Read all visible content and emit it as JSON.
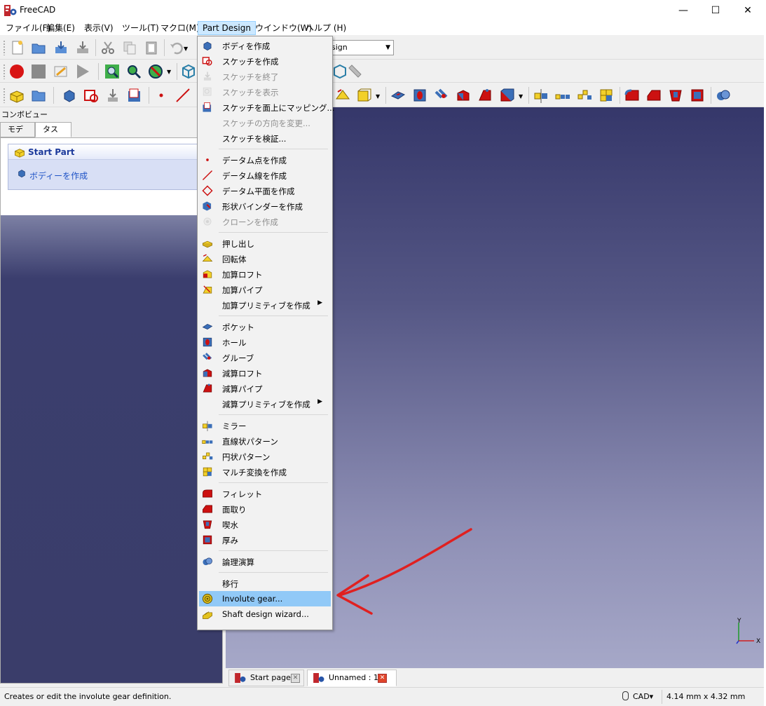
{
  "window": {
    "title": "FreeCAD",
    "minimize_glyph": "—",
    "maximize_glyph": "☐",
    "close_glyph": "✕"
  },
  "menubar": [
    "ファイル(F)",
    "編集(E)",
    "表示(V)",
    "ツール(T)",
    "マクロ(M)",
    "Part Design",
    "ウインドウ(W)",
    "ヘルプ (H)"
  ],
  "workbench_selector": {
    "value": "sign"
  },
  "combo_view": {
    "title": "コンボビュー",
    "tabs": [
      "モデル",
      "タスク"
    ],
    "active_tab": "タスク",
    "task_header": "Start Part",
    "task_item": "ボディーを作成"
  },
  "part_design_menu": {
    "items": [
      {
        "label": "ボディを作成",
        "icon": "body-icon",
        "enabled": true
      },
      {
        "label": "スケッチを作成",
        "icon": "sketch-icon",
        "enabled": true
      },
      {
        "label": "スケッチを終了",
        "icon": "sketch-leave-icon",
        "enabled": false
      },
      {
        "label": "スケッチを表示",
        "icon": "sketch-view-icon",
        "enabled": false
      },
      {
        "label": "スケッチを面上にマッピング...",
        "icon": "sketch-map-icon",
        "enabled": true
      },
      {
        "label": "スケッチの方向を変更...",
        "icon": "",
        "enabled": false
      },
      {
        "label": "スケッチを検証...",
        "icon": "",
        "enabled": true
      },
      {
        "label": "データム点を作成",
        "icon": "datum-point-icon",
        "enabled": true
      },
      {
        "label": "データム線を作成",
        "icon": "datum-line-icon",
        "enabled": true
      },
      {
        "label": "データム平面を作成",
        "icon": "datum-plane-icon",
        "enabled": true
      },
      {
        "label": "形状バインダーを作成",
        "icon": "shape-binder-icon",
        "enabled": true
      },
      {
        "label": "クローンを作成",
        "icon": "clone-icon",
        "enabled": false
      },
      {
        "label": "押し出し",
        "icon": "pad-icon",
        "enabled": true
      },
      {
        "label": "回転体",
        "icon": "revolution-icon",
        "enabled": true
      },
      {
        "label": "加算ロフト",
        "icon": "additive-loft-icon",
        "enabled": true
      },
      {
        "label": "加算パイプ",
        "icon": "additive-pipe-icon",
        "enabled": true
      },
      {
        "label": "加算プリミティブを作成",
        "icon": "",
        "enabled": true,
        "submenu": true
      },
      {
        "label": "ポケット",
        "icon": "pocket-icon",
        "enabled": true
      },
      {
        "label": "ホール",
        "icon": "hole-icon",
        "enabled": true
      },
      {
        "label": "グルーブ",
        "icon": "groove-icon",
        "enabled": true
      },
      {
        "label": "減算ロフト",
        "icon": "subtractive-loft-icon",
        "enabled": true
      },
      {
        "label": "減算パイプ",
        "icon": "subtractive-pipe-icon",
        "enabled": true
      },
      {
        "label": "減算プリミティブを作成",
        "icon": "",
        "enabled": true,
        "submenu": true
      },
      {
        "label": "ミラー",
        "icon": "mirror-icon",
        "enabled": true
      },
      {
        "label": "直線状パターン",
        "icon": "linear-pattern-icon",
        "enabled": true
      },
      {
        "label": "円状パターン",
        "icon": "polar-pattern-icon",
        "enabled": true
      },
      {
        "label": "マルチ変換を作成",
        "icon": "multitransform-icon",
        "enabled": true
      },
      {
        "label": "フィレット",
        "icon": "fillet-icon",
        "enabled": true
      },
      {
        "label": "面取り",
        "icon": "chamfer-icon",
        "enabled": true
      },
      {
        "label": "喫水",
        "icon": "draft-icon",
        "enabled": true
      },
      {
        "label": "厚み",
        "icon": "thickness-icon",
        "enabled": true
      },
      {
        "label": "論理演算",
        "icon": "boolean-icon",
        "enabled": true
      },
      {
        "label": "移行",
        "icon": "",
        "enabled": true
      },
      {
        "label": "Involute gear...",
        "icon": "gear-icon",
        "enabled": true,
        "highlighted": true
      },
      {
        "label": "Shaft design wizard...",
        "icon": "shaft-icon",
        "enabled": true
      }
    ],
    "submenu_glyph": "▶"
  },
  "doc_tabs": [
    {
      "label": "Start page",
      "active": false
    },
    {
      "label": "Unnamed : 1",
      "active": true
    }
  ],
  "statusbar": {
    "text": "Creates or edit the involute gear definition.",
    "nav_style": "CAD▾",
    "dimensions": "4.14 mm x 4.32 mm"
  },
  "axis": {
    "x": "X",
    "y": "Y"
  },
  "colors": {
    "highlight": "#91c9f7",
    "annotation_arrow": "#e02020",
    "view_top": "#35376a",
    "view_bottom": "#a6a8c8"
  }
}
